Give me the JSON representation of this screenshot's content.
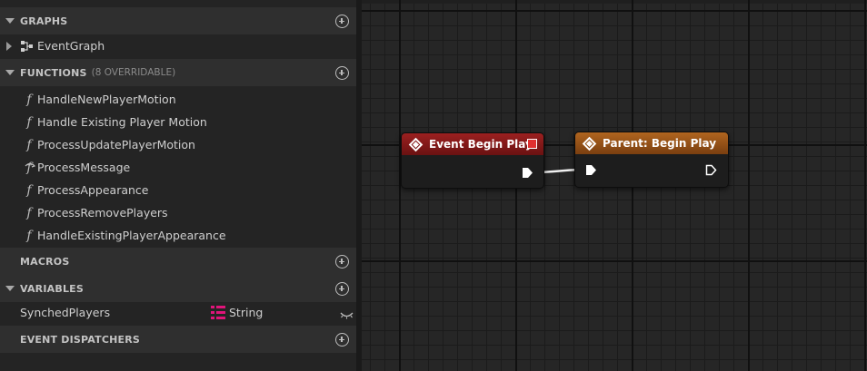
{
  "sections": {
    "graphs": {
      "title": "GRAPHS",
      "items": [
        {
          "label": "EventGraph",
          "icon": "event-graph-icon"
        }
      ]
    },
    "functions": {
      "title": "FUNCTIONS",
      "note": "(8 OVERRIDABLE)",
      "items": [
        {
          "label": "HandleNewPlayerMotion",
          "icon": "function-icon"
        },
        {
          "label": "Handle Existing Player Motion",
          "icon": "function-icon"
        },
        {
          "label": "ProcessUpdatePlayerMotion",
          "icon": "function-icon"
        },
        {
          "label": "ProcessMessage",
          "icon": "override-function-icon"
        },
        {
          "label": "ProcessAppearance",
          "icon": "function-icon"
        },
        {
          "label": "ProcessRemovePlayers",
          "icon": "function-icon"
        },
        {
          "label": "HandleExistingPlayerAppearance",
          "icon": "function-icon"
        }
      ]
    },
    "macros": {
      "title": "MACROS"
    },
    "variables": {
      "title": "VARIABLES",
      "items": [
        {
          "name": "SynchedPlayers",
          "type": "String",
          "type_icon": "array-icon",
          "visibility_icon": "eye-closed-icon"
        }
      ]
    },
    "event_dispatchers": {
      "title": "EVENT DISPATCHERS"
    }
  },
  "graph": {
    "nodes": [
      {
        "title": "Event Begin Play",
        "header_color": "#8c1a1a"
      },
      {
        "title": "Parent: Begin Play",
        "header_color": "#a3591a"
      }
    ]
  },
  "colors": {
    "panel_bg": "#242424",
    "section_header_bg": "#2f2f2f",
    "graph_bg": "#262626",
    "array_type_color": "#e0147a",
    "delegate_dot": "#e03030"
  }
}
